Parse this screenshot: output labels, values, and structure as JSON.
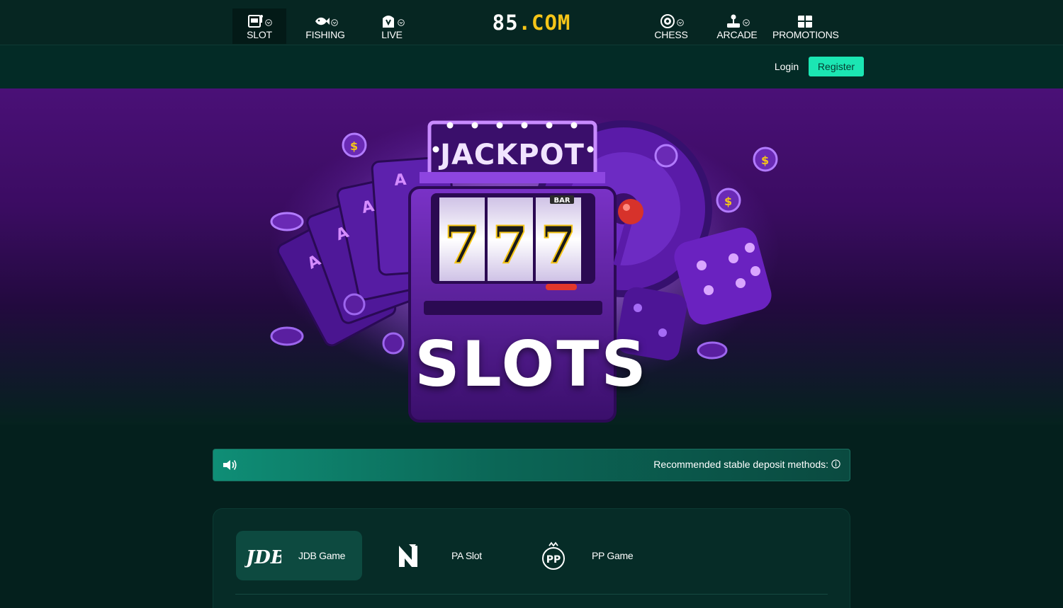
{
  "nav": {
    "items": [
      {
        "label": "SLOT",
        "icon": "slot-machine-icon",
        "active": true
      },
      {
        "label": "FISHING",
        "icon": "fish-icon",
        "active": false
      },
      {
        "label": "LIVE",
        "icon": "live-dealer-icon",
        "active": false
      },
      {
        "label": "CHESS",
        "icon": "poker-chip-icon",
        "active": false
      },
      {
        "label": "ARCADE",
        "icon": "joystick-icon",
        "active": false
      },
      {
        "label": "PROMOTIONS",
        "icon": "gift-icon",
        "active": false
      }
    ],
    "logo": {
      "main": "85",
      "accent": ".COM"
    }
  },
  "auth": {
    "login": "Login",
    "register": "Register"
  },
  "hero": {
    "title": "SLOTS",
    "sign": "JACKPOT",
    "reels": [
      "7",
      "7",
      "7"
    ],
    "reel_tag": "BAR"
  },
  "notice": {
    "message": "Recommended stable deposit methods:"
  },
  "providers": [
    {
      "name": "JDB Game",
      "logo": "JDB",
      "active": true
    },
    {
      "name": "PA Slot",
      "logo": "PA",
      "active": false
    },
    {
      "name": "PP Game",
      "logo": "PP",
      "active": false
    }
  ],
  "colors": {
    "accent": "#1be6b3",
    "background": "#04201d",
    "hero_purple": "#4a1077",
    "coin_gold": "#f5c518"
  }
}
